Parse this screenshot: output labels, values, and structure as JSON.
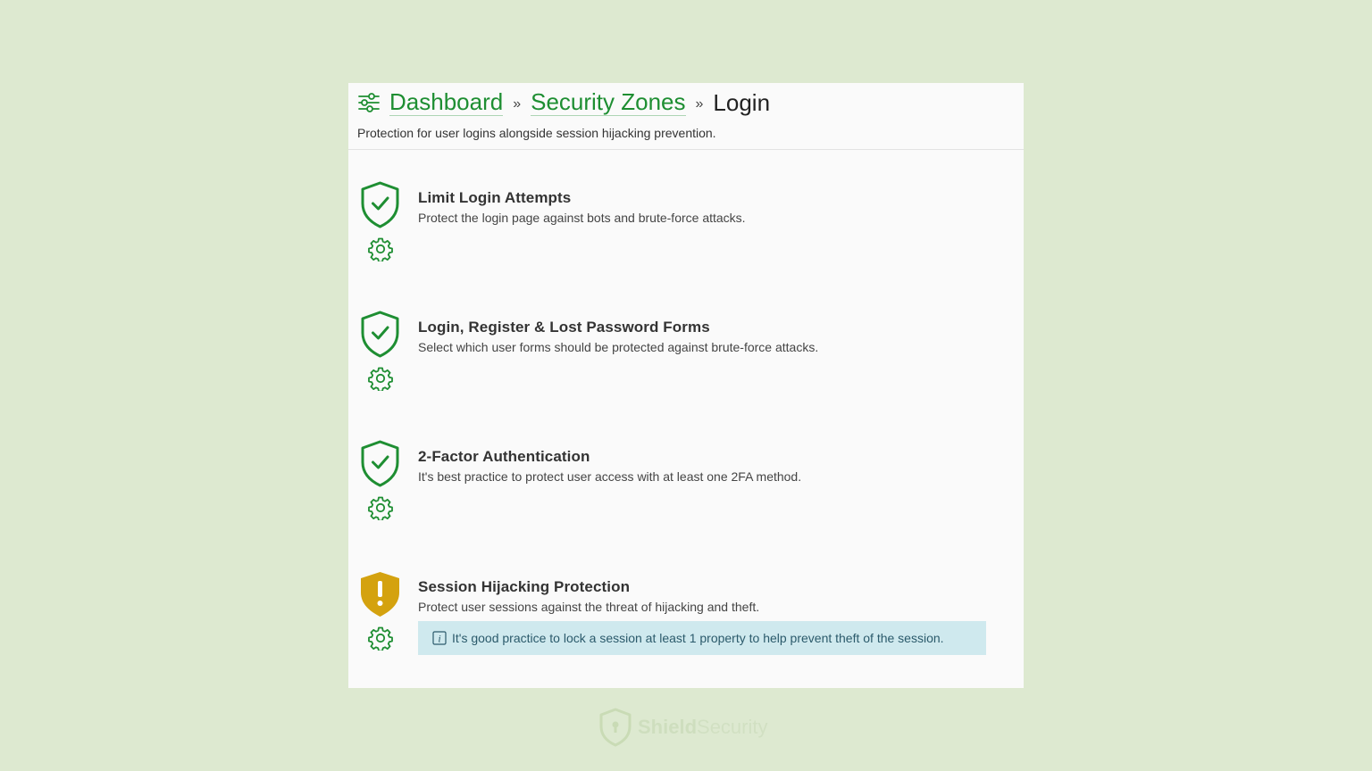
{
  "breadcrumb": {
    "icon": "sliders-icon",
    "items": [
      "Dashboard",
      "Security Zones"
    ],
    "current": "Login",
    "separator": "»"
  },
  "subtitle": "Protection for user logins alongside session hijacking prevention.",
  "zones": [
    {
      "title": "Limit Login Attempts",
      "description": "Protect the login page against bots and brute-force attacks.",
      "status": "good",
      "status_icon": "shield-check-icon"
    },
    {
      "title": "Login, Register & Lost Password Forms",
      "description": "Select which user forms should be protected against brute-force attacks.",
      "status": "good",
      "status_icon": "shield-check-icon"
    },
    {
      "title": "2-Factor Authentication",
      "description": "It's best practice to protect user access with at least one 2FA method.",
      "status": "good",
      "status_icon": "shield-check-icon"
    },
    {
      "title": "Session Hijacking Protection",
      "description": "Protect user sessions against the threat of hijacking and theft.",
      "status": "warning",
      "status_icon": "shield-warning-icon",
      "notice": "It's good practice to lock a session at least 1 property to help prevent theft of the session."
    }
  ],
  "brand": {
    "name_bold": "Shield",
    "name_regular": "Security"
  },
  "colors": {
    "background": "#dde9d0",
    "accent_green": "#1e8e32",
    "warning_gold": "#d4a20f",
    "notice_bg": "#cfe9ee"
  }
}
